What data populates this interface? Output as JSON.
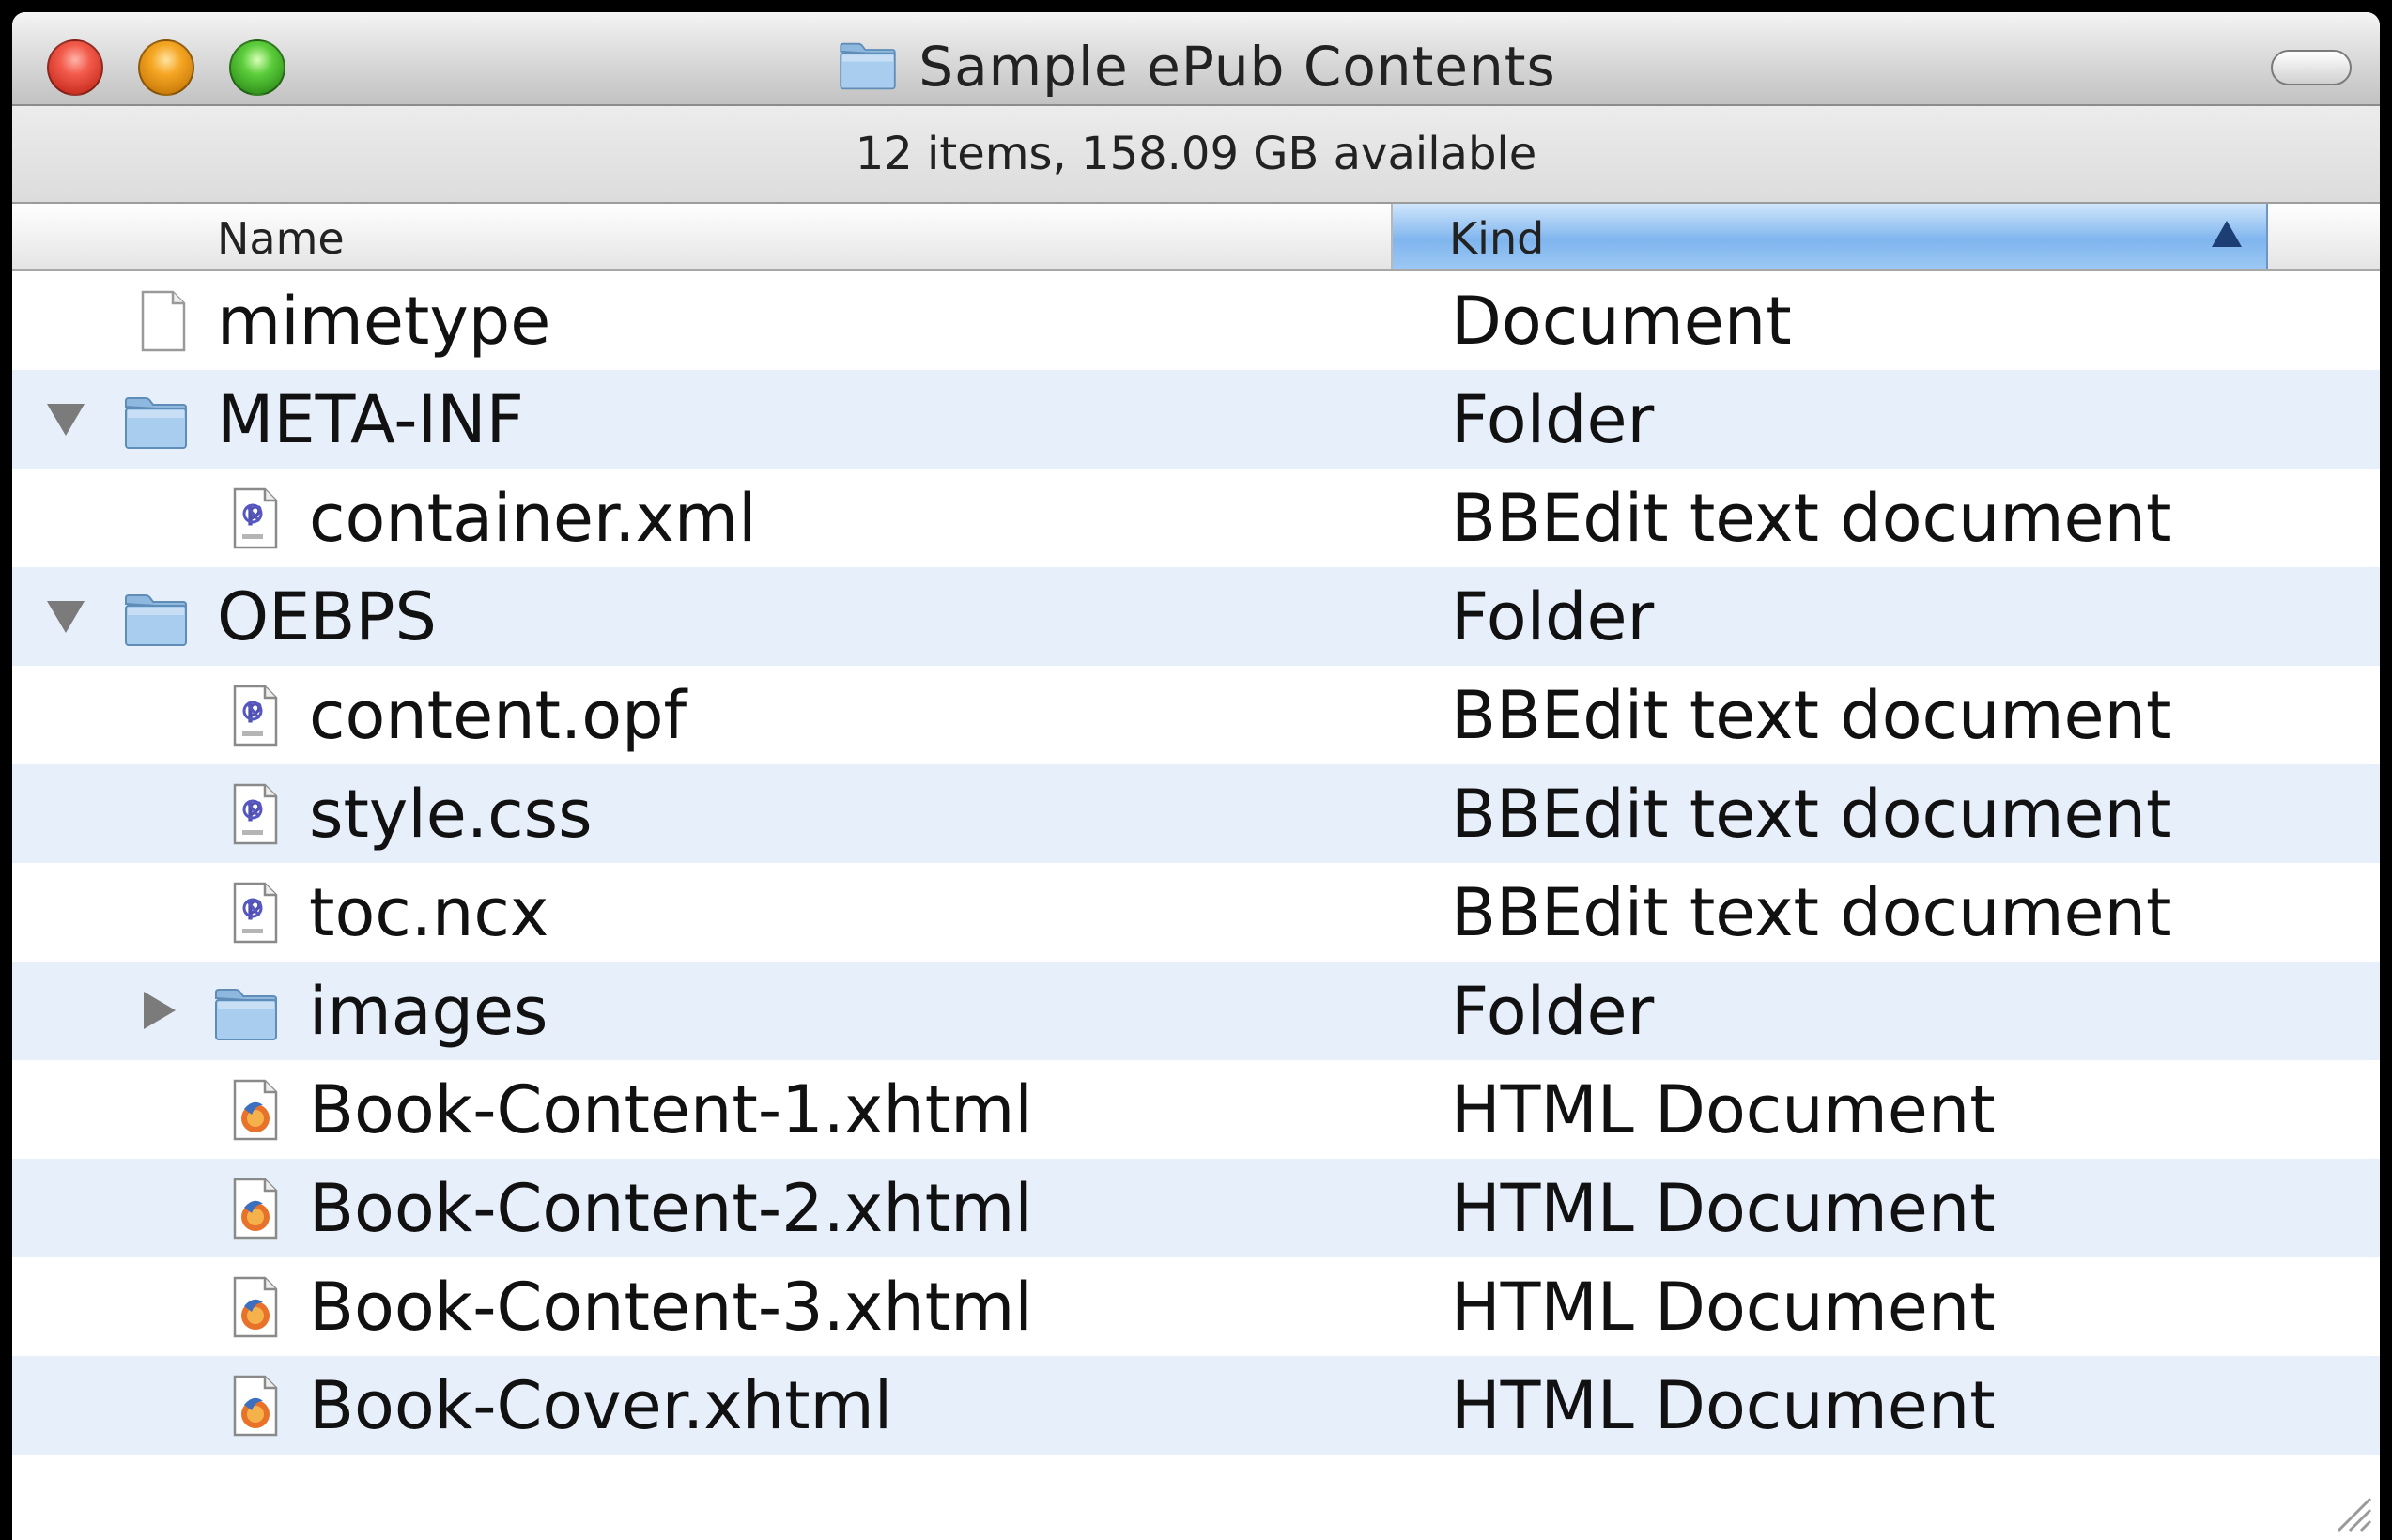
{
  "window": {
    "title": "Sample ePub Contents",
    "status": "12 items, 158.09 GB available"
  },
  "columns": {
    "name": "Name",
    "kind": "Kind",
    "sorted_by": "kind",
    "sort_direction": "ascending"
  },
  "colors": {
    "folder": "#9cc3e6",
    "selected_column": "#7fb5ee",
    "alt_row": "#e7effb"
  },
  "rows": [
    {
      "name": "mimetype",
      "kind": "Document",
      "icon": "document-icon"
    },
    {
      "name": "META-INF",
      "kind": "Folder",
      "icon": "folder-icon",
      "disclosure": "expanded"
    },
    {
      "name": "container.xml",
      "kind": "BBEdit text document",
      "icon": "bbedit-document-icon"
    },
    {
      "name": "OEBPS",
      "kind": "Folder",
      "icon": "folder-icon",
      "disclosure": "expanded"
    },
    {
      "name": "content.opf",
      "kind": "BBEdit text document",
      "icon": "bbedit-document-icon"
    },
    {
      "name": "style.css",
      "kind": "BBEdit text document",
      "icon": "bbedit-document-icon"
    },
    {
      "name": "toc.ncx",
      "kind": "BBEdit text document",
      "icon": "bbedit-document-icon"
    },
    {
      "name": "images",
      "kind": "Folder",
      "icon": "folder-icon",
      "disclosure": "collapsed"
    },
    {
      "name": "Book-Content-1.xhtml",
      "kind": "HTML Document",
      "icon": "html-document-icon"
    },
    {
      "name": "Book-Content-2.xhtml",
      "kind": "HTML Document",
      "icon": "html-document-icon"
    },
    {
      "name": "Book-Content-3.xhtml",
      "kind": "HTML Document",
      "icon": "html-document-icon"
    },
    {
      "name": "Book-Cover.xhtml",
      "kind": "HTML Document",
      "icon": "html-document-icon"
    }
  ]
}
